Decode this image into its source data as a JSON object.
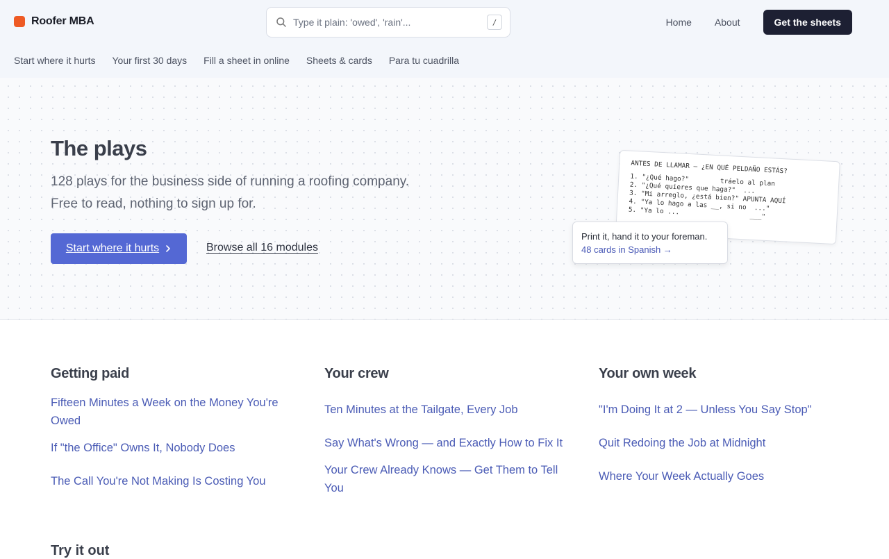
{
  "brand": {
    "name": "Roofer MBA"
  },
  "search": {
    "placeholder": "Type it plain: 'owed', 'rain'...",
    "shortcut": "/"
  },
  "topnav": {
    "home": "Home",
    "about": "About",
    "cta": "Get the sheets"
  },
  "subnav": [
    "Start where it hurts",
    "Your first 30 days",
    "Fill a sheet in online",
    "Sheets & cards",
    "Para tu cuadrilla"
  ],
  "hero": {
    "title": "The plays",
    "subtitle": "128 plays for the business side of running a roofing company. Free to read, nothing to sign up for.",
    "primary_button": "Start where it hurts",
    "secondary_link": "Browse all 16 modules"
  },
  "card": {
    "title": "ANTES DE LLAMAR — ¿EN QUÉ PELDAÑO ESTÁS?",
    "lines": [
      "1. \"¿Qué hago?\"        tráelo al plan",
      "2. \"¿Qué quieres que haga?\"  ...",
      "3. \"Mi arreglo, ¿está bien?\" APUNTA AQUÍ",
      "4. \"Ya lo hago a las __, si no  ...\"",
      "5. \"Ya lo ...                  ___\""
    ]
  },
  "note": {
    "line1": "Print it, hand it to your foreman.",
    "link": "48 cards in Spanish →"
  },
  "sections": [
    {
      "title": "Getting paid",
      "items": [
        "Fifteen Minutes a Week on the Money You're Owed",
        "If \"the Office\" Owns It, Nobody Does",
        "The Call You're Not Making Is Costing You"
      ]
    },
    {
      "title": "Your crew",
      "items": [
        "Ten Minutes at the Tailgate, Every Job",
        "Say What's Wrong — and Exactly How to Fix It",
        "Your Crew Already Knows — Get Them to Tell You"
      ]
    },
    {
      "title": "Your own week",
      "items": [
        "\"I'm Doing It at 2 — Unless You Say Stop\"",
        "Quit Redoing the Job at Midnight",
        "Where Your Week Actually Goes"
      ]
    }
  ],
  "try_heading": "Try it out",
  "colors": {
    "accent": "#5468d4",
    "link": "#4a5bb5",
    "cta_dark": "#1d2033",
    "logo": "#ee5a24"
  }
}
